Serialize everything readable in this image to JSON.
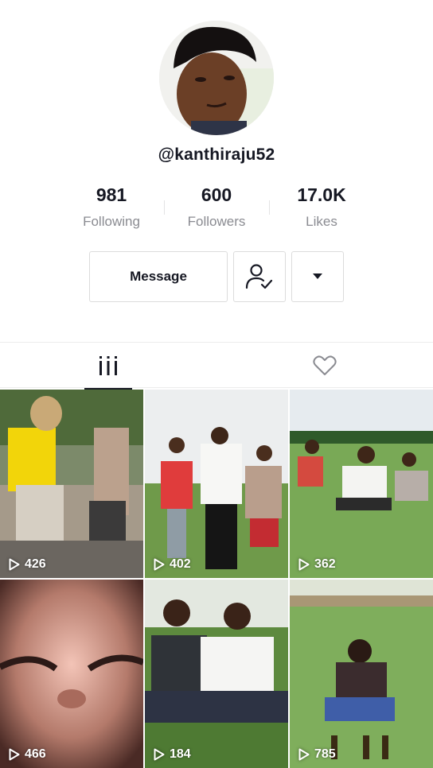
{
  "profile": {
    "username": "@kanthiraju52",
    "avatar_icon": "profile-photo"
  },
  "stats": [
    {
      "value": "981",
      "label": "Following"
    },
    {
      "value": "600",
      "label": "Followers"
    },
    {
      "value": "17.0K",
      "label": "Likes"
    }
  ],
  "actions": {
    "message_label": "Message",
    "follow_icon": "user-check-icon",
    "more_icon": "caret-down-icon"
  },
  "tabs": [
    {
      "name": "videos",
      "icon": "grid-icon",
      "active": true
    },
    {
      "name": "liked",
      "icon": "heart-icon",
      "active": false
    }
  ],
  "videos": [
    {
      "views": "426"
    },
    {
      "views": "402"
    },
    {
      "views": "362"
    },
    {
      "views": "466"
    },
    {
      "views": "184"
    },
    {
      "views": "785"
    }
  ],
  "colors": {
    "text_primary": "#161823",
    "text_secondary": "#8a8b91",
    "border": "#dcdcdc"
  }
}
